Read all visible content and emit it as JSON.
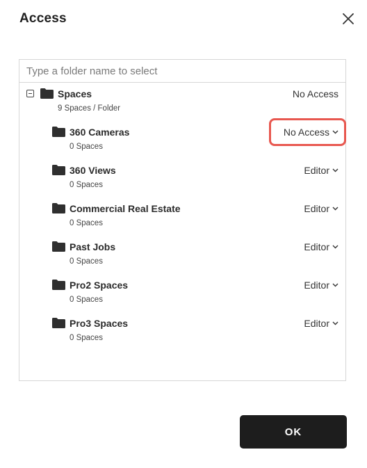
{
  "dialog": {
    "title": "Access",
    "close_icon": "close-icon"
  },
  "search": {
    "placeholder": "Type a folder name to select",
    "value": ""
  },
  "root": {
    "name": "Spaces",
    "subtitle": "9 Spaces / Folder",
    "access": "No Access"
  },
  "folders": [
    {
      "name": "360 Cameras",
      "subtitle": "0 Spaces",
      "access": "No Access",
      "highlighted": true
    },
    {
      "name": "360 Views",
      "subtitle": "0 Spaces",
      "access": "Editor"
    },
    {
      "name": "Commercial Real Estate",
      "subtitle": "0 Spaces",
      "access": "Editor"
    },
    {
      "name": "Past Jobs",
      "subtitle": "0 Spaces",
      "access": "Editor"
    },
    {
      "name": "Pro2 Spaces",
      "subtitle": "0 Spaces",
      "access": "Editor"
    },
    {
      "name": "Pro3 Spaces",
      "subtitle": "0 Spaces",
      "access": "Editor"
    }
  ],
  "footer": {
    "ok_label": "OK"
  },
  "colors": {
    "highlight": "#e8574f",
    "button_bg": "#1d1d1d"
  }
}
